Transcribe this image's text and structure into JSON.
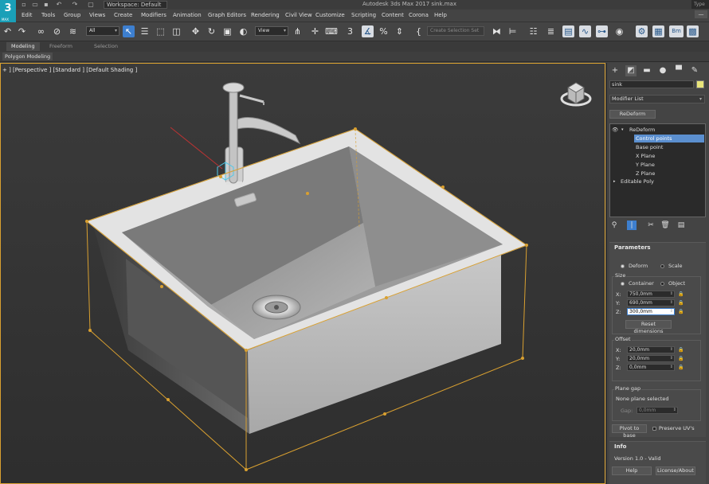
{
  "titlebar": {
    "logo": "3",
    "logo_sub": "MAX",
    "workspace": "Workspace: Default",
    "window_title": "Autodesk 3ds Max 2017    sink.max",
    "search": "Type"
  },
  "menu": [
    "Edit",
    "Tools",
    "Group",
    "Views",
    "Create",
    "Modifiers",
    "Animation",
    "Graph Editors",
    "Rendering",
    "Civil View",
    "Customize",
    "Scripting",
    "Content",
    "Corona",
    "Help"
  ],
  "toolbar": {
    "filter": "All",
    "ref_coord": "View",
    "selection_set": "Create Selection Set"
  },
  "ribbon": {
    "tabs": [
      "Modeling",
      "Freeform",
      "Selection"
    ],
    "sub": "Polygon Modeling"
  },
  "viewport": {
    "label": "+ ] [Perspective ] [Standard ] [Default Shading ]"
  },
  "command_panel": {
    "object_name": "sink",
    "object_color": "#e8e47a",
    "modifier_list": "Modifier List",
    "redeform_button": "ReDeform",
    "stack": [
      {
        "label": "ReDeform",
        "selected": false
      },
      {
        "label": "Control points",
        "selected": true
      },
      {
        "label": "Base point",
        "selected": false
      },
      {
        "label": "X Plane",
        "selected": false
      },
      {
        "label": "Y Plane",
        "selected": false
      },
      {
        "label": "Z Plane",
        "selected": false
      },
      {
        "label": "Editable Poly",
        "selected": false
      }
    ],
    "parameters": {
      "title": "Parameters",
      "deform": "Deform",
      "scale": "Scale",
      "size_label": "Size",
      "container": "Container",
      "object": "Object",
      "x_label": "X:",
      "x_value": "750,0mm",
      "y_label": "Y:",
      "y_value": "690,0mm",
      "z_label": "Z:",
      "z_value": "300,0mm",
      "reset_dimensions": "Reset dimensions",
      "offset_label": "Offset",
      "ox_label": "X:",
      "ox_value": "20,0mm",
      "oy_label": "Y:",
      "oy_value": "20,0mm",
      "oz_label": "Z:",
      "oz_value": "0,0mm",
      "plane_gap_label": "Plane gap",
      "plane_gap_status": "None plane selected",
      "gap_label": "Gap:",
      "gap_value": "0,0mm",
      "pivot_to_base": "Pivot to base",
      "preserve_uvs": "Preserve UV's"
    },
    "info": {
      "title": "Info",
      "version": "Version 1.0 - Valid",
      "help": "Help",
      "license": "License/About"
    }
  },
  "colors": {
    "accent_blue": "#3d7fcf",
    "selection_orange": "#d9a030",
    "logo_teal": "#1aa0b8"
  }
}
